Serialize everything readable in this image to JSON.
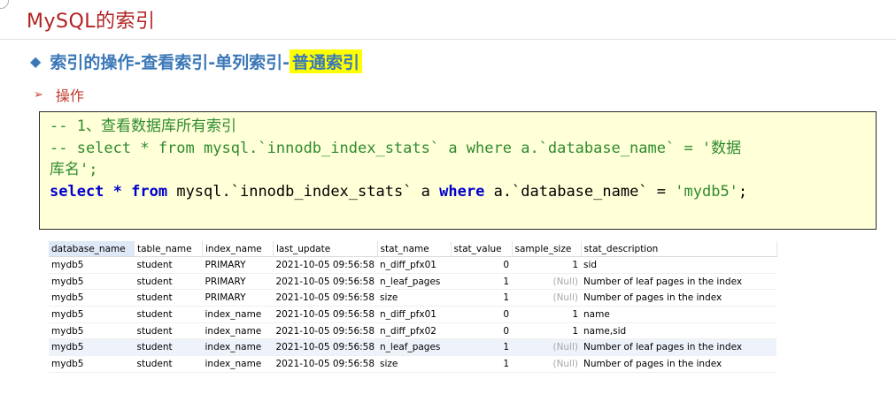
{
  "title": "MySQL的索引",
  "heading": {
    "main": "索引的操作-查看索引-单列索引-",
    "highlight": "普通索引"
  },
  "subheading": "操作",
  "code": {
    "line1": "-- 1、查看数据库所有索引",
    "line2": "-- select * from mysql.`innodb_index_stats` a where a.`database_name` = '数据",
    "line3": "库名';",
    "line4": {
      "kw_select": "select",
      "star": " * ",
      "kw_from": "from",
      "mid": " mysql.`innodb_index_stats` a ",
      "kw_where": "where",
      "cond": " a.`database_name` = ",
      "str": "'mydb5'",
      "end": ";"
    }
  },
  "table": {
    "columns": [
      "database_name",
      "table_name",
      "index_name",
      "last_update",
      "stat_name",
      "stat_value",
      "sample_size",
      "stat_description"
    ],
    "rows": [
      [
        "mydb5",
        "student",
        "PRIMARY",
        "2021-10-05 09:56:58",
        "n_diff_pfx01",
        "0",
        "1",
        "sid"
      ],
      [
        "mydb5",
        "student",
        "PRIMARY",
        "2021-10-05 09:56:58",
        "n_leaf_pages",
        "1",
        "(Null)",
        "Number of leaf pages in the index"
      ],
      [
        "mydb5",
        "student",
        "PRIMARY",
        "2021-10-05 09:56:58",
        "size",
        "1",
        "(Null)",
        "Number of pages in the index"
      ],
      [
        "mydb5",
        "student",
        "index_name",
        "2021-10-05 09:56:58",
        "n_diff_pfx01",
        "0",
        "1",
        "name"
      ],
      [
        "mydb5",
        "student",
        "index_name",
        "2021-10-05 09:56:58",
        "n_diff_pfx02",
        "0",
        "1",
        "name,sid"
      ],
      [
        "mydb5",
        "student",
        "index_name",
        "2021-10-05 09:56:58",
        "n_leaf_pages",
        "1",
        "(Null)",
        "Number of leaf pages in the index"
      ],
      [
        "mydb5",
        "student",
        "index_name",
        "2021-10-05 09:56:58",
        "size",
        "1",
        "(Null)",
        "Number of pages in the index"
      ]
    ]
  },
  "colors": {
    "title": "#b22222",
    "heading": "#3c78b8",
    "highlight": "#ffff00",
    "code_bg": "#ffffd8",
    "comment": "#2e8b2e",
    "keyword": "#0000cc"
  }
}
